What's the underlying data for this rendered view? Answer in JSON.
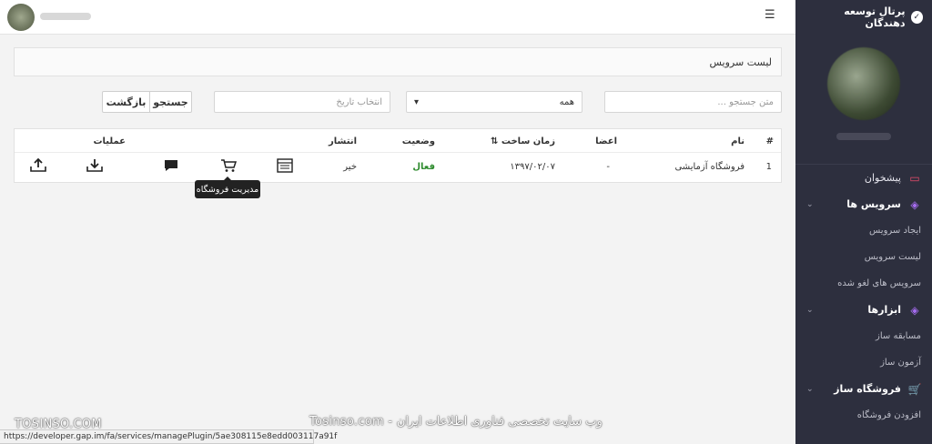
{
  "sidebar": {
    "brand": "پرتال توسعه دهندگان",
    "items": [
      {
        "label": "پیشخوان",
        "icon": "monitor-icon"
      },
      {
        "label": "سرویس ها",
        "icon": "tag-icon"
      },
      {
        "label": "ایجاد سرویس"
      },
      {
        "label": "لیست سرویس"
      },
      {
        "label": "سرویس های لغو شده"
      },
      {
        "label": "ابزارها",
        "icon": "tag-icon"
      },
      {
        "label": "مسابقه ساز"
      },
      {
        "label": "آزمون ساز"
      },
      {
        "label": "فروشگاه ساز",
        "icon": "cart-icon"
      },
      {
        "label": "افزودن فروشگاه"
      }
    ]
  },
  "panel": {
    "title": "لیست سرویس"
  },
  "filters": {
    "search_placeholder": "متن جستجو ...",
    "status_selected": "همه",
    "date_placeholder": "انتخاب تاریخ",
    "search_button": "جستجو",
    "back_button": "بازگشت"
  },
  "table": {
    "headers": {
      "index": "#",
      "name": "نام",
      "members": "اعضا",
      "created": "زمان ساخت ⇅",
      "status": "وضعیت",
      "publish": "انتشار",
      "actions": "عملیات"
    },
    "rows": [
      {
        "index": "1",
        "name": "فروشگاه آزمایشی",
        "members": "-",
        "created": "۱۳۹۷/۰۲/۰۷",
        "status": "فعال",
        "publish": "خیر"
      }
    ]
  },
  "tooltip": "مدیریت فروشگاه",
  "watermark_left": "TOSINSO.COM",
  "watermark_center": "Tosinso.com - وب سایت تخصصی فناوری اطلاعات ایران",
  "status_url": "https://developer.gap.im/fa/services/managePlugin/5ae308115e8edd003117a91f",
  "colors": {
    "sidebar_bg": "#2d2f3e",
    "active_status": "#2e8b2e",
    "accent_monitor": "#e84c6c",
    "accent_purple": "#a56cf0"
  }
}
